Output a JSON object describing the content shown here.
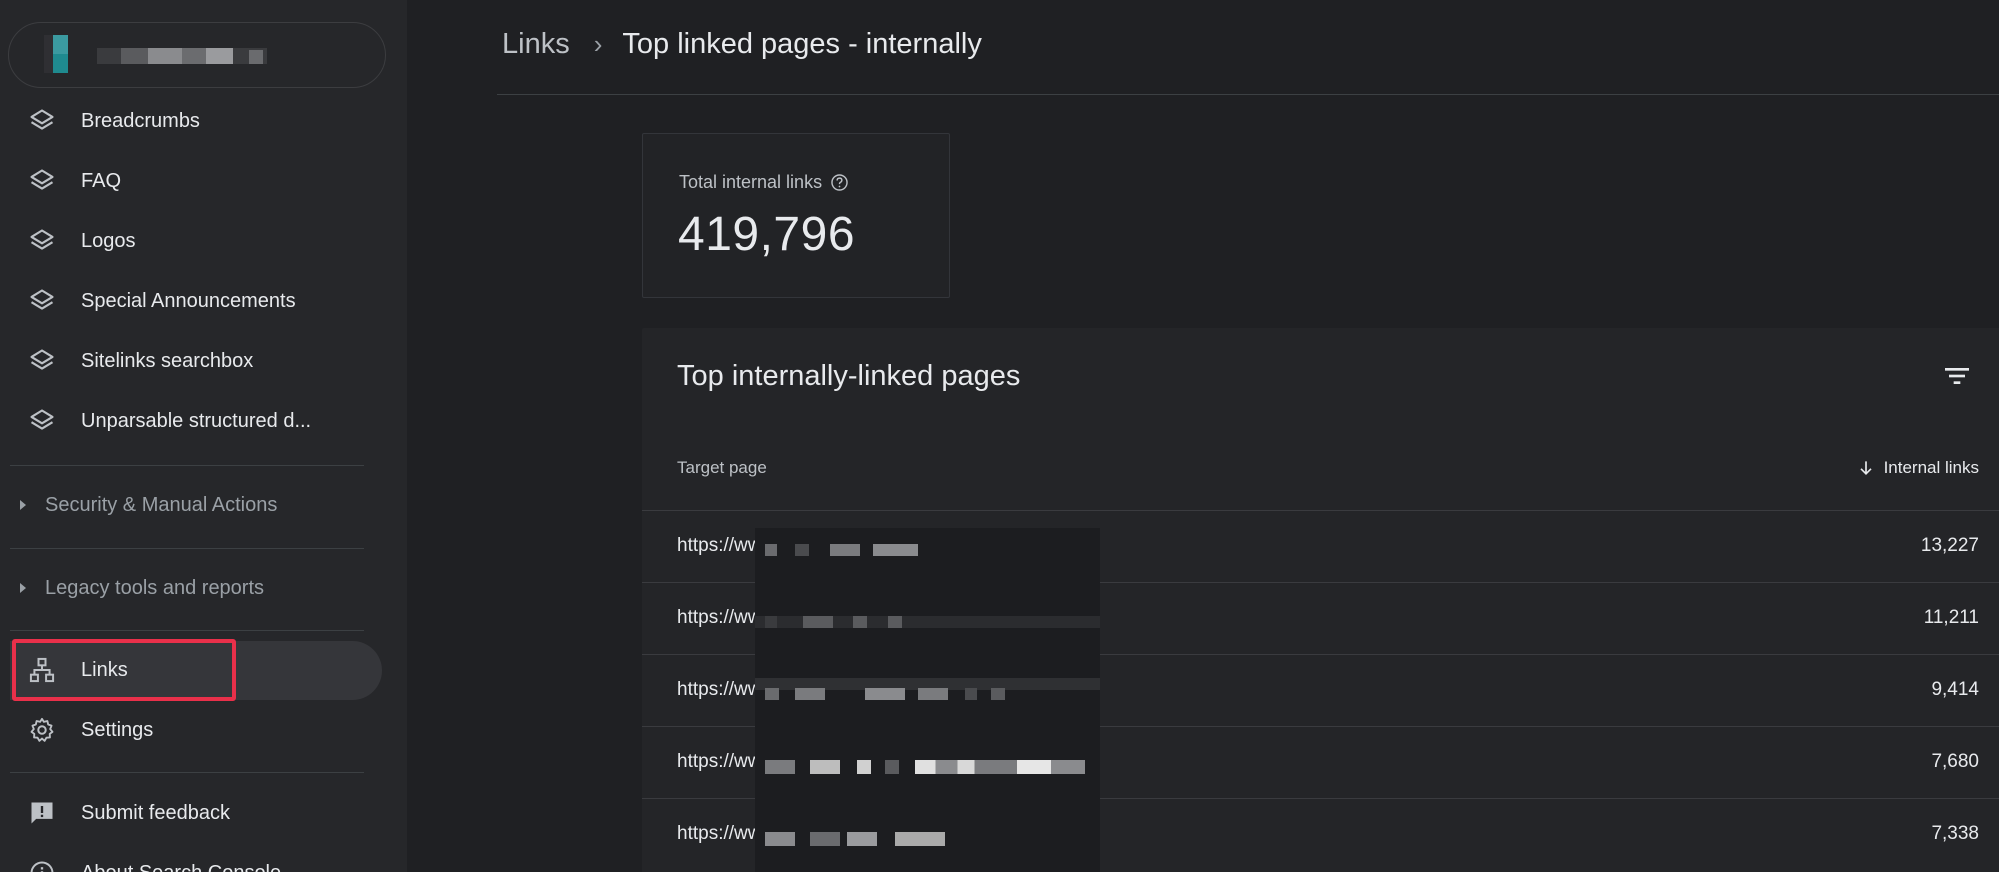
{
  "sidebar": {
    "items_top": [
      {
        "label": "Breadcrumbs",
        "icon": "layers-icon"
      },
      {
        "label": "FAQ",
        "icon": "layers-icon"
      },
      {
        "label": "Logos",
        "icon": "layers-icon"
      },
      {
        "label": "Special Announcements",
        "icon": "layers-icon"
      },
      {
        "label": "Sitelinks searchbox",
        "icon": "layers-icon"
      },
      {
        "label": "Unparsable structured d...",
        "icon": "layers-icon"
      }
    ],
    "sections": [
      {
        "label": "Security & Manual Actions"
      },
      {
        "label": "Legacy tools and reports"
      }
    ],
    "items_bottom": [
      {
        "label": "Links",
        "icon": "network-icon",
        "active": true
      },
      {
        "label": "Settings",
        "icon": "gear-icon"
      }
    ],
    "footer_items": [
      {
        "label": "Submit feedback",
        "icon": "feedback-icon"
      },
      {
        "label": "About Search Console",
        "icon": "info-icon"
      }
    ]
  },
  "breadcrumb": {
    "root": "Links",
    "current": "Top linked pages - internally"
  },
  "stat": {
    "label": "Total internal links",
    "value": "419,796"
  },
  "table": {
    "title": "Top internally-linked pages",
    "col_target": "Target page",
    "col_links": "Internal links",
    "rows": [
      {
        "url": "https://www.",
        "links": "13,227"
      },
      {
        "url": "https://www.",
        "links": "11,211"
      },
      {
        "url": "https://www.",
        "links": "9,414"
      },
      {
        "url": "https://www.",
        "links": "7,680"
      },
      {
        "url": "https://www.",
        "links": "7,338"
      }
    ]
  },
  "colors": {
    "highlight": "#e9304a",
    "background": "#202124",
    "sidebar": "#26272a"
  }
}
